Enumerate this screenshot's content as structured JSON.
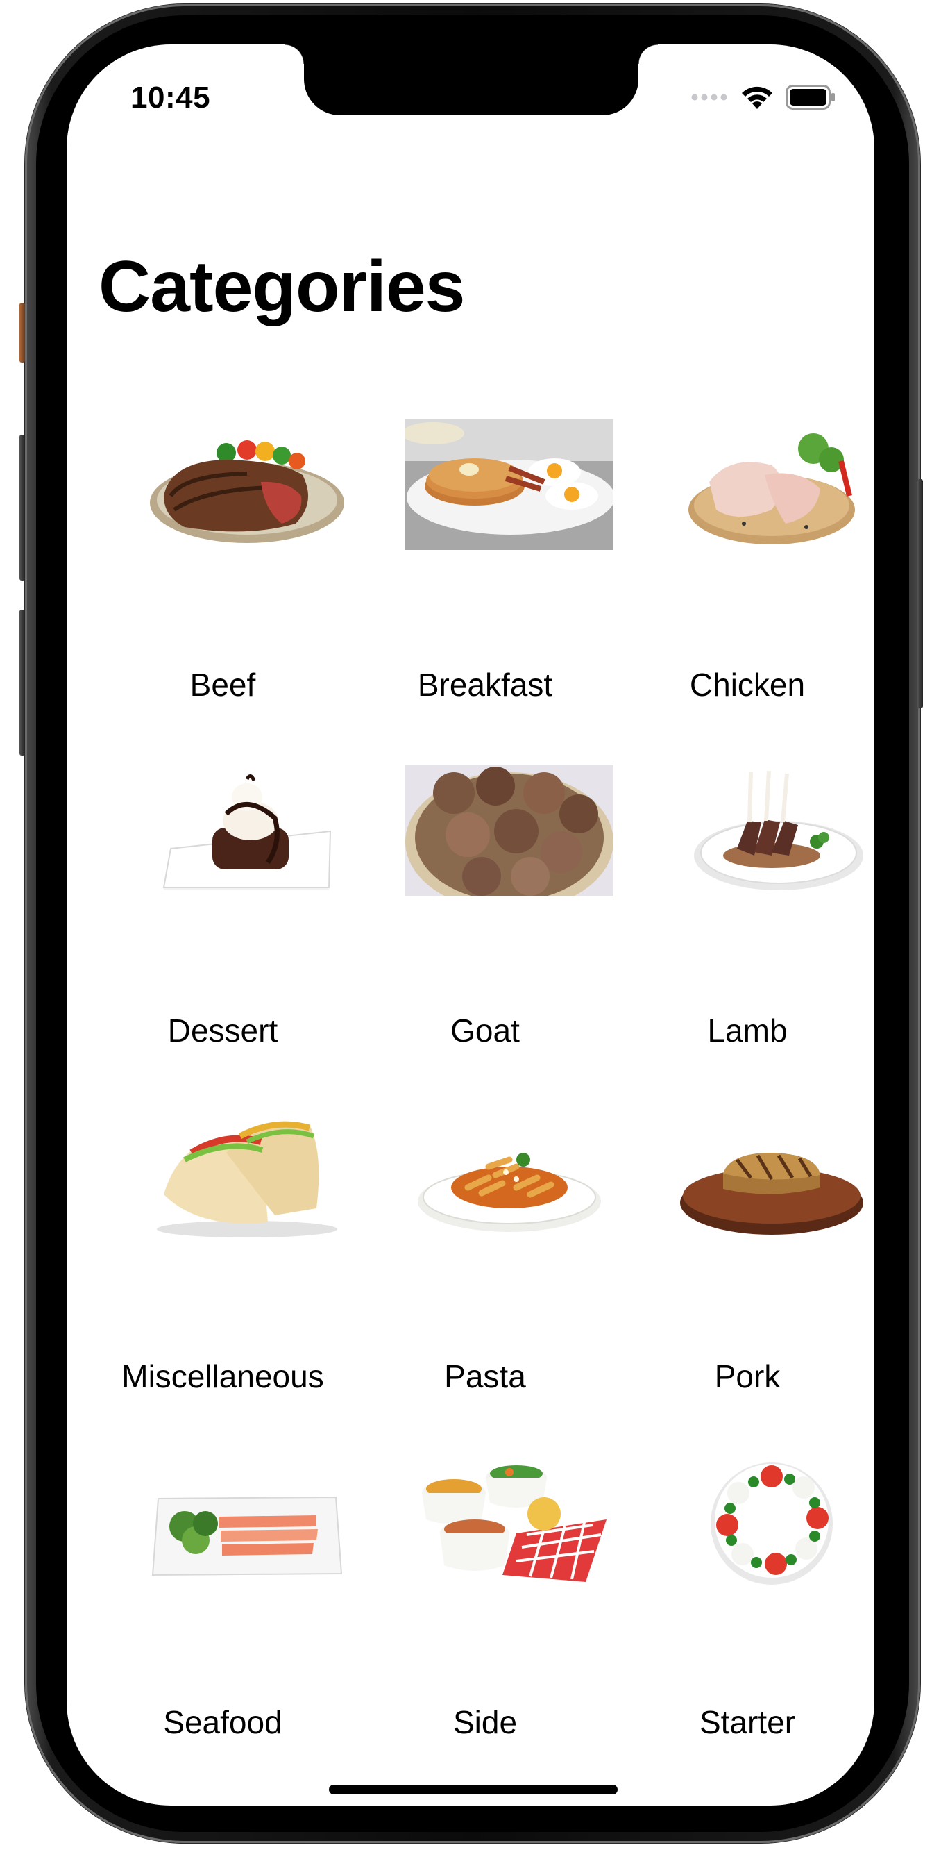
{
  "status_bar": {
    "time": "10:45"
  },
  "page": {
    "title": "Categories"
  },
  "categories": [
    {
      "label": "Beef",
      "icon": "beef-steak-photo"
    },
    {
      "label": "Breakfast",
      "icon": "pancakes-eggs-photo"
    },
    {
      "label": "Chicken",
      "icon": "raw-chicken-photo"
    },
    {
      "label": "Dessert",
      "icon": "brownie-sundae-photo"
    },
    {
      "label": "Goat",
      "icon": "goat-meat-bowl-photo"
    },
    {
      "label": "Lamb",
      "icon": "lamb-rack-photo"
    },
    {
      "label": "Miscellaneous",
      "icon": "tacos-photo"
    },
    {
      "label": "Pasta",
      "icon": "penne-pasta-photo"
    },
    {
      "label": "Pork",
      "icon": "grilled-pork-photo"
    },
    {
      "label": "Seafood",
      "icon": "salmon-platter-photo"
    },
    {
      "label": "Side",
      "icon": "side-dishes-photo"
    },
    {
      "label": "Starter",
      "icon": "caprese-salad-photo"
    }
  ]
}
